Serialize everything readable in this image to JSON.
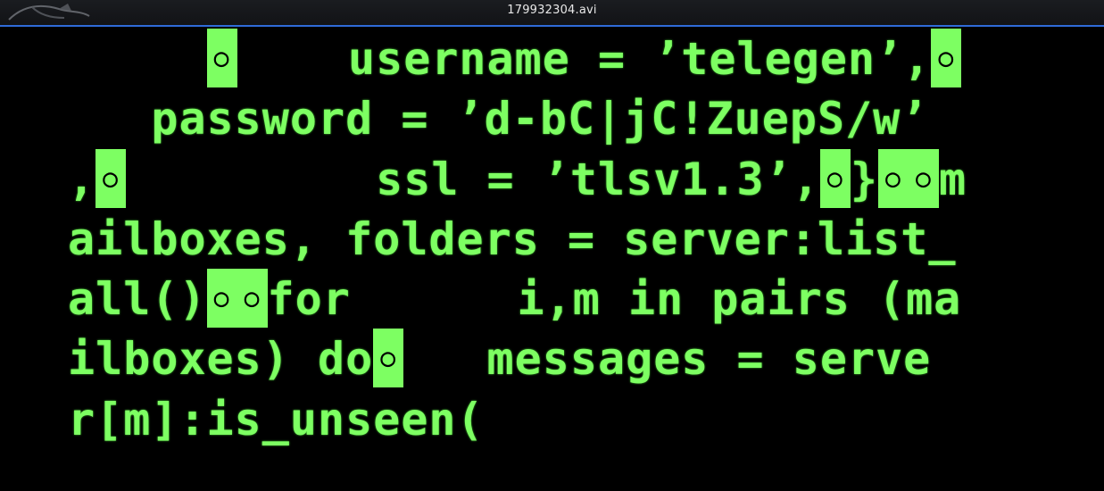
{
  "window": {
    "title": "179932304.avi"
  },
  "terminal": {
    "lines": [
      "     ◘    username = ’telegen’,◘",
      "   password = ’d-bC|jC!ZuepS/w’",
      ",◘         ssl = ’tlsv1.3’,◘}◘◘m",
      "ailboxes, folders = server:list_",
      "all()◘◘for      i,m in pairs (ma",
      "ilboxes) do◘   messages = serve",
      "r[m]:is_unseen("
    ]
  },
  "colors": {
    "phosphor_green": "#7dff62",
    "background": "#000000",
    "titlebar_accent": "#2f6bd8"
  },
  "icons": {
    "app": "dragon-logo-icon"
  }
}
